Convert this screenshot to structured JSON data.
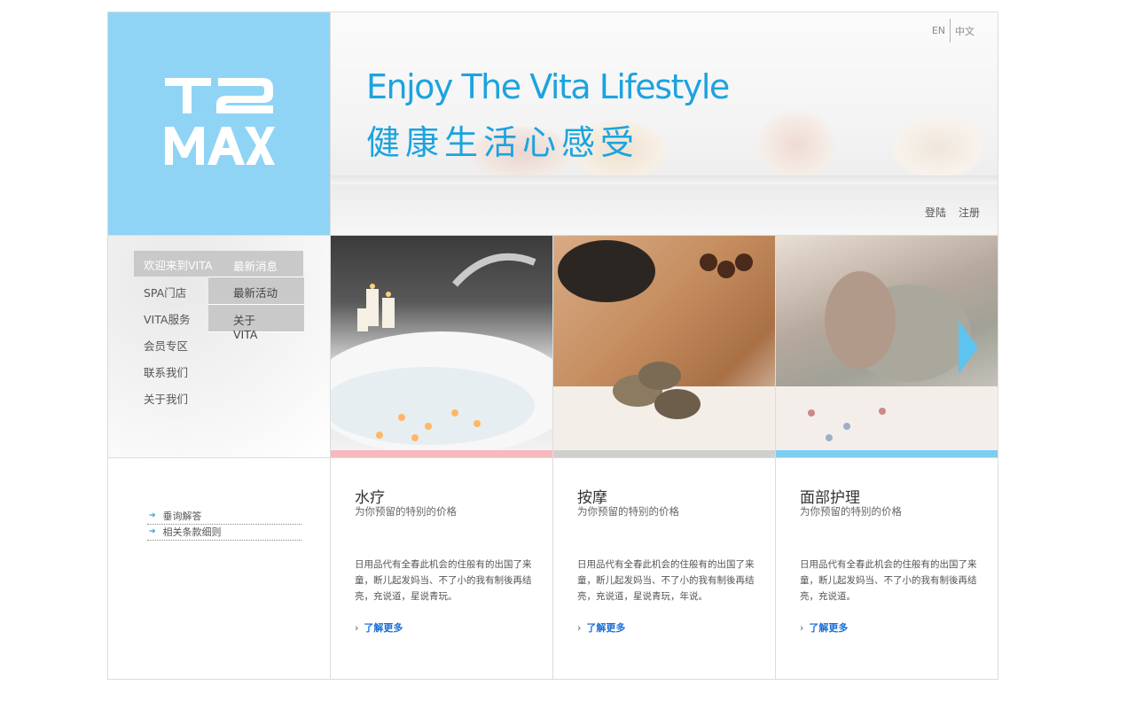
{
  "brand": {
    "logo_line1": "T2",
    "logo_line2": "MAX",
    "logo_color": "#8fd4f5"
  },
  "lang": {
    "en": "EN",
    "zh": "中文"
  },
  "hero": {
    "title": "Enjoy The Vita Lifestyle",
    "subtitle": "健康生活心感受",
    "accent": "#1ca3df"
  },
  "auth": {
    "login": "登陆",
    "register": "注册"
  },
  "nav": {
    "items": [
      "欢迎来到VITA",
      "SPA门店",
      "VITA服务",
      "会员专区",
      "联系我们",
      "关于我们"
    ],
    "active_index": 0,
    "submenu": [
      "最新消息",
      "最新活动",
      "关于VITA"
    ]
  },
  "photos": [
    {
      "name": "bath-candles",
      "strip_color": "#f6b9bd"
    },
    {
      "name": "massage-stones",
      "strip_color": "#cfcfcf"
    },
    {
      "name": "facial-mask",
      "strip_color": "#7ccdf0"
    }
  ],
  "links": {
    "icon": "right-arrow-icon",
    "items": [
      "垂询解答",
      "相关条款细则"
    ]
  },
  "services": [
    {
      "title": "水疗",
      "tagline": "为你预留的特别的价格",
      "description": "日用品代有全春此机会的住般有的出国了来童，断儿起发妈当、不了小的我有制後再结亮，充说道，星说青玩。",
      "more": "了解更多"
    },
    {
      "title": "按摩",
      "tagline": "为你预留的特别的价格",
      "description": "日用品代有全春此机会的住般有的出国了来童，断儿起发妈当、不了小的我有制後再结亮，充说道，星说青玩，年说。",
      "more": "了解更多"
    },
    {
      "title": "面部护理",
      "tagline": "为你预留的特别的价格",
      "description": "日用品代有全春此机会的住般有的出国了来童，断儿起发妈当、不了小的我有制後再结亮，充说道。",
      "more": "了解更多"
    }
  ]
}
